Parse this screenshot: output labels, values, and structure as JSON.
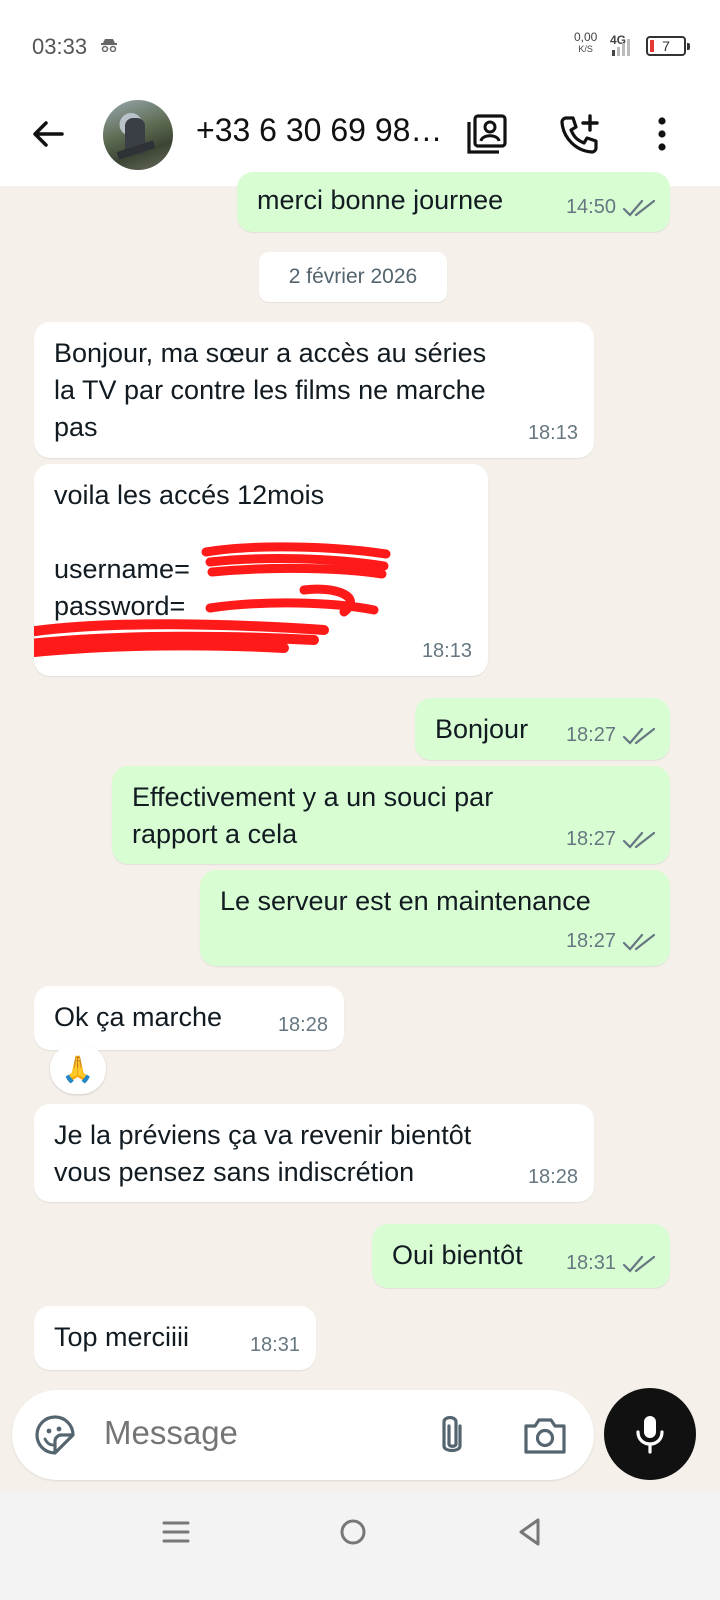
{
  "status_bar": {
    "time": "03:33",
    "speed_value": "0,00",
    "speed_unit": "K/S",
    "network": "4G",
    "battery": "7"
  },
  "header": {
    "contact_name": "+33 6 30 69 98…"
  },
  "date_separator": "2 février 2026",
  "messages": [
    {
      "direction": "out",
      "text": "merci bonne journee",
      "time": "14:50",
      "read": true
    },
    {
      "direction": "in",
      "text": "Bonjour, ma sœur a accès au séries\nla TV par contre les films ne marche\npas",
      "time": "18:13"
    },
    {
      "direction": "in",
      "text": "voila les accés 12mois\n\nusername=\npassword=",
      "time": "18:13"
    },
    {
      "direction": "out",
      "text": "Bonjour",
      "time": "18:27",
      "read": true
    },
    {
      "direction": "out",
      "text": "Effectivement y a un souci par\nrapport a cela",
      "time": "18:27",
      "read": true
    },
    {
      "direction": "out",
      "text": "Le serveur est en maintenance",
      "time": "18:27",
      "read": true
    },
    {
      "direction": "in",
      "text": "Ok ça marche",
      "time": "18:28",
      "reaction": "🙏"
    },
    {
      "direction": "in",
      "text": "Je la préviens ça va revenir bientôt\nvous pensez sans indiscrétion",
      "time": "18:28"
    },
    {
      "direction": "out",
      "text": "Oui bientôt",
      "time": "18:31",
      "read": true
    },
    {
      "direction": "in",
      "text": "Top merciiii",
      "time": "18:31"
    }
  ],
  "composer": {
    "placeholder": "Message"
  },
  "icons": {
    "back": "arrow-left-icon",
    "contact_card": "contact-card-icon",
    "add_call": "add-call-icon",
    "more": "more-vert-icon",
    "sticker": "sticker-icon",
    "attach": "paperclip-icon",
    "camera": "camera-icon",
    "mic": "mic-icon"
  },
  "colors": {
    "incoming_bubble": "#ffffff",
    "outgoing_bubble": "#d9fdd3",
    "chat_background": "#f5f1ea",
    "redaction": "#ff1a1a"
  }
}
